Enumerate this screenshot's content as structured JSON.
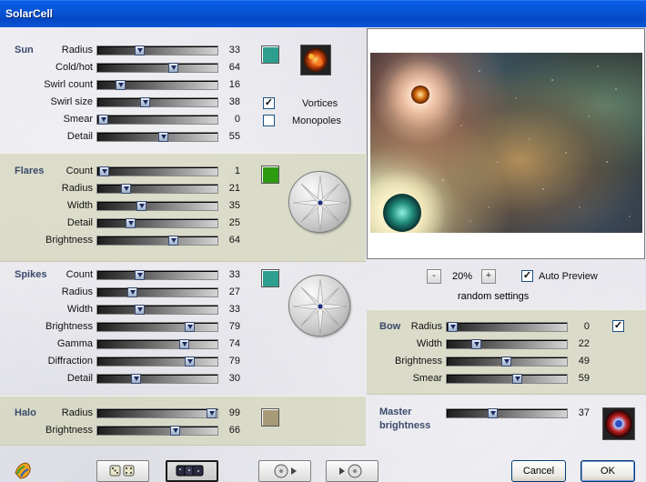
{
  "window": {
    "title": "SolarCell"
  },
  "sun": {
    "title": "Sun",
    "sliders": [
      {
        "label": "Radius",
        "value": "33",
        "fraction": 0.33
      },
      {
        "label": "Cold/hot",
        "value": "64",
        "fraction": 0.64
      },
      {
        "label": "Swirl count",
        "value": "16",
        "fraction": 0.16
      },
      {
        "label": "Swirl size",
        "value": "38",
        "fraction": 0.38
      },
      {
        "label": "Smear",
        "value": "0",
        "fraction": 0.0
      },
      {
        "label": "Detail",
        "value": "55",
        "fraction": 0.55
      }
    ],
    "color": "#2e9e90",
    "vortices": {
      "label": "Vortices",
      "checked": true
    },
    "monopoles": {
      "label": "Monopoles",
      "checked": false
    }
  },
  "flares": {
    "title": "Flares",
    "sliders": [
      {
        "label": "Count",
        "value": "1",
        "fraction": 0.01
      },
      {
        "label": "Radius",
        "value": "21",
        "fraction": 0.21
      },
      {
        "label": "Width",
        "value": "35",
        "fraction": 0.35
      },
      {
        "label": "Detail",
        "value": "25",
        "fraction": 0.25
      },
      {
        "label": "Brightness",
        "value": "64",
        "fraction": 0.64
      }
    ],
    "color": "#2e9a10"
  },
  "spikes": {
    "title": "Spikes",
    "sliders": [
      {
        "label": "Count",
        "value": "33",
        "fraction": 0.33
      },
      {
        "label": "Radius",
        "value": "27",
        "fraction": 0.27
      },
      {
        "label": "Width",
        "value": "33",
        "fraction": 0.33
      },
      {
        "label": "Brightness",
        "value": "79",
        "fraction": 0.79
      },
      {
        "label": "Gamma",
        "value": "74",
        "fraction": 0.74
      },
      {
        "label": "Diffraction",
        "value": "79",
        "fraction": 0.79
      },
      {
        "label": "Detail",
        "value": "30",
        "fraction": 0.3
      }
    ],
    "color": "#2e9e90"
  },
  "halo": {
    "title": "Halo",
    "sliders": [
      {
        "label": "Radius",
        "value": "99",
        "fraction": 0.99
      },
      {
        "label": "Brightness",
        "value": "66",
        "fraction": 0.66
      }
    ],
    "color": "#a89a78"
  },
  "preview": {
    "zoom_minus": "-",
    "zoom": "20%",
    "zoom_plus": "+",
    "auto_preview": {
      "label": "Auto Preview",
      "checked": true
    },
    "random_settings": "random settings"
  },
  "bow": {
    "title": "Bow",
    "sliders": [
      {
        "label": "Radius",
        "value": "0",
        "fraction": 0.0
      },
      {
        "label": "Width",
        "value": "22",
        "fraction": 0.22
      },
      {
        "label": "Brightness",
        "value": "49",
        "fraction": 0.49
      },
      {
        "label": "Smear",
        "value": "59",
        "fraction": 0.59
      }
    ],
    "enabled": true
  },
  "master": {
    "title_line1": "Master",
    "title_line2": "brightness",
    "value": "37",
    "fraction": 0.37
  },
  "footer": {
    "cancel_label": "Cancel",
    "ok_label": "OK"
  }
}
